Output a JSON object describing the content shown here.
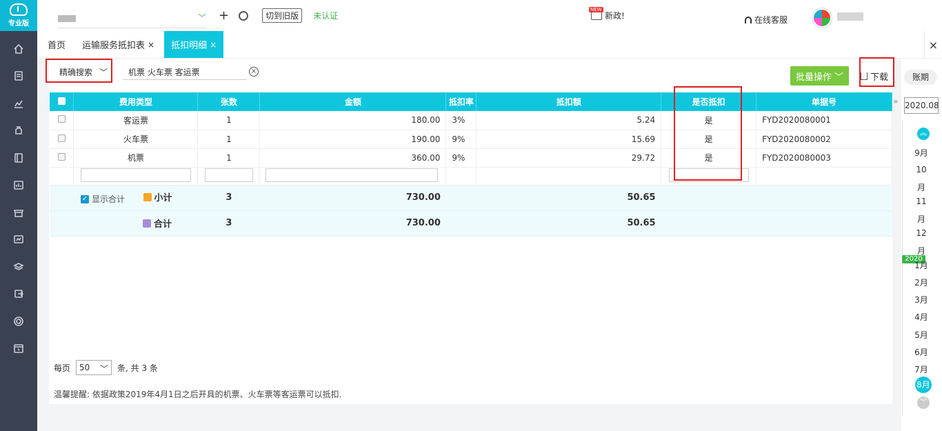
{
  "sidebar": {
    "logo_label": "专业版",
    "icons": [
      "home-icon",
      "invoice-icon",
      "chart-icon",
      "money-bag-icon",
      "ledger-icon",
      "report-icon",
      "shop-icon",
      "finance-icon",
      "stack-icon",
      "export-icon",
      "gear-icon",
      "calendar-icon"
    ]
  },
  "topbar": {
    "switch_old_label": "切到旧版",
    "unverified_label": "未认证",
    "news_label": "新政!",
    "news_badge": "NEW",
    "service_label": "在线客服"
  },
  "tabs": [
    {
      "label": "首页"
    },
    {
      "label": "运输服务抵扣表"
    },
    {
      "label": "抵扣明细"
    }
  ],
  "toolbar": {
    "search_mode": "精确搜索",
    "search_value": "机票 火车票 客运票",
    "batch_label": "批量操作",
    "download_label": "下载"
  },
  "table": {
    "columns": [
      "费用类型",
      "张数",
      "金额",
      "抵扣率",
      "抵扣额",
      "是否抵扣",
      "单据号"
    ],
    "rows": [
      {
        "type": "客运票",
        "count": "1",
        "amount": "180.00",
        "rate": "3%",
        "deduct": "5.24",
        "is_deduct": "是",
        "doc": "FYD2020080001"
      },
      {
        "type": "火车票",
        "count": "1",
        "amount": "190.00",
        "rate": "9%",
        "deduct": "15.69",
        "is_deduct": "是",
        "doc": "FYD2020080002"
      },
      {
        "type": "机票",
        "count": "1",
        "amount": "360.00",
        "rate": "9%",
        "deduct": "29.72",
        "is_deduct": "是",
        "doc": "FYD2020080003"
      }
    ],
    "show_total_label": "显示合计",
    "subtotal": {
      "label": "小计",
      "count": "3",
      "amount": "730.00",
      "deduct": "50.65"
    },
    "total": {
      "label": "合计",
      "count": "3",
      "amount": "730.00",
      "deduct": "50.65"
    }
  },
  "pager": {
    "per_page_label": "每页",
    "per_page_value": "50",
    "summary": "条, 共 3 条"
  },
  "tip": "温馨提醒: 依据政策2019年4月1日之后开具的机票、火车票等客运票可以抵扣.",
  "period": {
    "title": "账期",
    "current": "2020.08",
    "year_mark": "2020",
    "months": [
      "9月",
      "10",
      "月",
      "11",
      "月",
      "12",
      "月",
      "1月",
      "2月",
      "3月",
      "4月",
      "5月",
      "6月",
      "7月"
    ],
    "current_month": "8月"
  }
}
